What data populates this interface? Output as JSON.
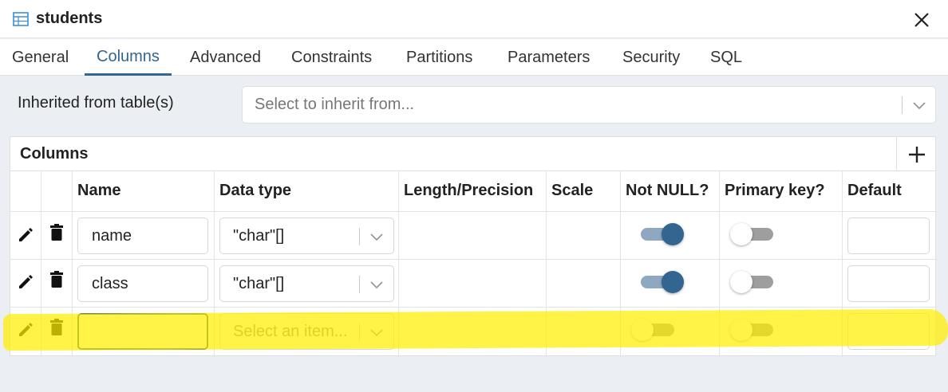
{
  "window": {
    "title": "students",
    "icon": "table-icon",
    "close_icon": "close-icon"
  },
  "tabs": [
    {
      "label": "General",
      "active": false
    },
    {
      "label": "Columns",
      "active": true
    },
    {
      "label": "Advanced",
      "active": false
    },
    {
      "label": "Constraints",
      "active": false
    },
    {
      "label": "Partitions",
      "active": false
    },
    {
      "label": "Parameters",
      "active": false
    },
    {
      "label": "Security",
      "active": false
    },
    {
      "label": "SQL",
      "active": false
    }
  ],
  "inherit": {
    "label": "Inherited from table(s)",
    "placeholder": "Select to inherit from..."
  },
  "columns_panel": {
    "title": "Columns",
    "add_icon": "plus-icon",
    "headers": [
      "Name",
      "Data type",
      "Length/Precision",
      "Scale",
      "Not NULL?",
      "Primary key?",
      "Default"
    ],
    "rows": [
      {
        "name": "name",
        "data_type": "\"char\"[]",
        "not_null": true,
        "primary_key": false,
        "default": ""
      },
      {
        "name": "class",
        "data_type": "\"char\"[]",
        "not_null": true,
        "primary_key": false,
        "default": ""
      },
      {
        "name": "",
        "data_type": "",
        "data_type_placeholder": "Select an item...",
        "not_null": false,
        "primary_key": false,
        "default": ""
      }
    ]
  },
  "colors": {
    "accent": "#326690",
    "highlight": "#ffee00",
    "toggle_on_track": "#8fa8c2",
    "toggle_off_track": "#9e9e9e"
  }
}
